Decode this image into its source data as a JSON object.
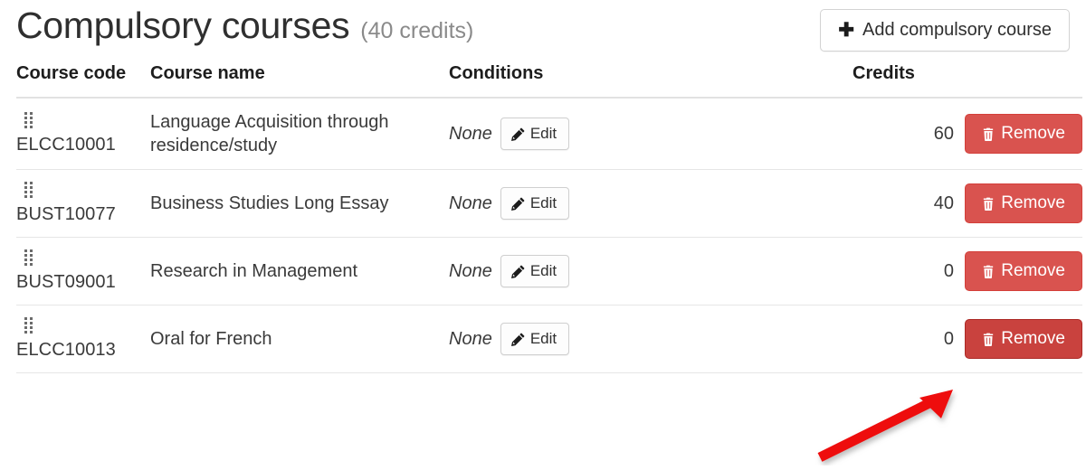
{
  "header": {
    "title": "Compulsory courses",
    "credits_label": "(40 credits)",
    "add_button": {
      "label": "Add compulsory course",
      "icon": "plus-icon"
    }
  },
  "table": {
    "columns": [
      "Course code",
      "Course name",
      "Conditions",
      "Credits",
      ""
    ],
    "row_actions": {
      "edit_label": "Edit",
      "edit_icon": "pencil-icon",
      "remove_label": "Remove",
      "remove_icon": "trash-icon",
      "drag_icon": "drag-handle-icon"
    },
    "rows": [
      {
        "code": "ELCC10001",
        "name": "Language Acquisition through residence/study",
        "conditions": "None",
        "credits": "60"
      },
      {
        "code": "BUST10077",
        "name": "Business Studies Long Essay",
        "conditions": "None",
        "credits": "40"
      },
      {
        "code": "BUST09001",
        "name": "Research in Management",
        "conditions": "None",
        "credits": "0"
      },
      {
        "code": "ELCC10013",
        "name": "Oral for French",
        "conditions": "None",
        "credits": "0"
      }
    ]
  },
  "annotation": {
    "type": "arrow",
    "color": "#ee1111",
    "points_to": "remove-button-row-4"
  },
  "colors": {
    "danger": "#d9534f",
    "danger_hover": "#c9423e",
    "text": "#3a3a3a",
    "muted": "#8a8a8a",
    "border": "#e6e6e6",
    "annotation_red": "#ee1111"
  }
}
